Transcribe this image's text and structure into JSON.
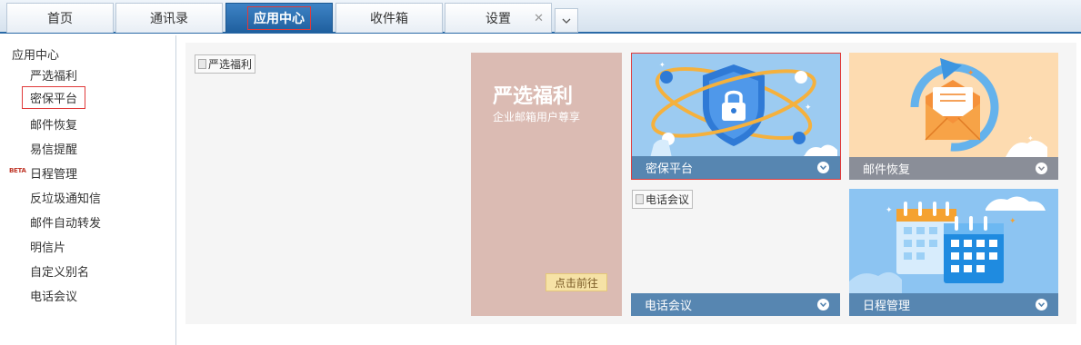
{
  "tabs": [
    {
      "label": "首页"
    },
    {
      "label": "通讯录"
    },
    {
      "label": "应用中心"
    },
    {
      "label": "收件箱"
    },
    {
      "label": "设置"
    }
  ],
  "sidebar": {
    "header": "应用中心",
    "beta_badge": "BETA",
    "items": [
      {
        "label": "严选福利"
      },
      {
        "label": "密保平台"
      },
      {
        "label": "邮件恢复"
      },
      {
        "label": "易信提醒"
      },
      {
        "label": "日程管理"
      },
      {
        "label": "反垃圾通知信"
      },
      {
        "label": "邮件自动转发"
      },
      {
        "label": "明信片"
      },
      {
        "label": "自定义别名"
      },
      {
        "label": "电话会议"
      }
    ]
  },
  "main": {
    "banner_alt": "严选福利",
    "promo": {
      "title": "严选福利",
      "subtitle": "企业邮箱用户尊享",
      "button": "点击前往"
    },
    "cards": {
      "secure": "密保平台",
      "recover": "邮件恢复",
      "phone_alt": "电话会议",
      "phone": "电话会议",
      "calendar": "日程管理"
    }
  },
  "colors": {
    "tab_active": "#2a6aa7",
    "promo_bg": "#dbbbb3",
    "caption_blue": "#5786b1",
    "caption_grey": "#8a8e98",
    "selection_border": "#e03a3a"
  }
}
